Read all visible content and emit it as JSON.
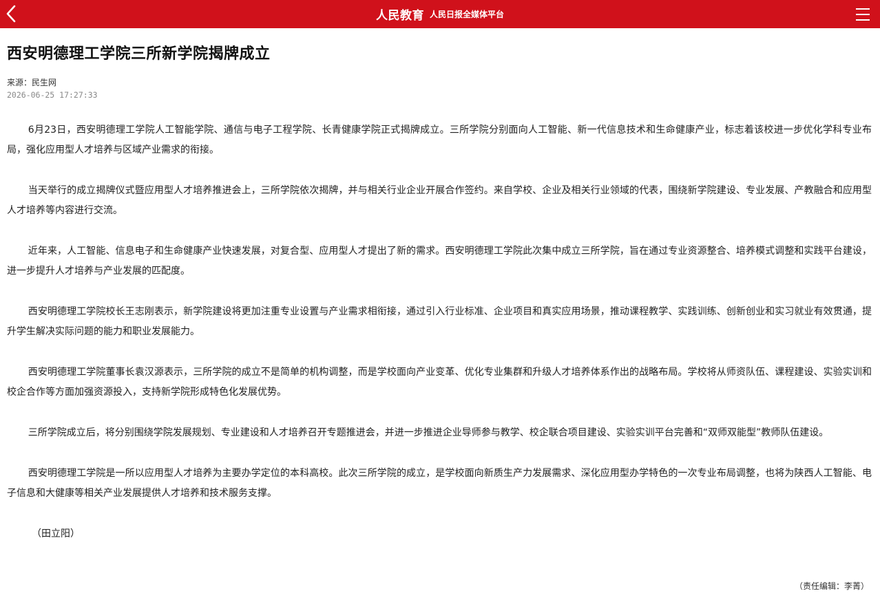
{
  "header": {
    "brand": "人民教育",
    "subtitle": "人民日报全媒体平台",
    "accent_color": "#d0111b",
    "left_icon": "chevron-left-icon",
    "right_icon": "hamburger-menu-icon"
  },
  "article": {
    "title": "西安明德理工学院三所新学院揭牌成立",
    "source": "来源：民生网",
    "date": "2026-06-25 17:27:33",
    "paragraphs": [
      "6月23日，西安明德理工学院人工智能学院、通信与电子工程学院、长青健康学院正式揭牌成立。三所学院分别面向人工智能、新一代信息技术和生命健康产业，标志着该校进一步优化学科专业布局，强化应用型人才培养与区域产业需求的衔接。",
      "当天举行的成立揭牌仪式暨应用型人才培养推进会上，三所学院依次揭牌，并与相关行业企业开展合作签约。来自学校、企业及相关行业领域的代表，围绕新学院建设、专业发展、产教融合和应用型人才培养等内容进行交流。",
      "近年来，人工智能、信息电子和生命健康产业快速发展，对复合型、应用型人才提出了新的需求。西安明德理工学院此次集中成立三所学院，旨在通过专业资源整合、培养模式调整和实践平台建设，进一步提升人才培养与产业发展的匹配度。",
      "西安明德理工学院校长王志刚表示，新学院建设将更加注重专业设置与产业需求相衔接，通过引入行业标准、企业项目和真实应用场景，推动课程教学、实践训练、创新创业和实习就业有效贯通，提升学生解决实际问题的能力和职业发展能力。",
      "西安明德理工学院董事长袁汉源表示，三所学院的成立不是简单的机构调整，而是学校面向产业变革、优化专业集群和升级人才培养体系作出的战略布局。学校将从师资队伍、课程建设、实验实训和校企合作等方面加强资源投入，支持新学院形成特色化发展优势。",
      "三所学院成立后，将分别围绕学院发展规划、专业建设和人才培养召开专题推进会，并进一步推进企业导师参与教学、校企联合项目建设、实验实训平台完善和“双师双能型”教师队伍建设。",
      "西安明德理工学院是一所以应用型人才培养为主要办学定位的本科高校。此次三所学院的成立，是学校面向新质生产力发展需求、深化应用型办学特色的一次专业布局调整，也将为陕西人工智能、电子信息和大健康等相关产业发展提供人才培养和技术服务支撑。"
    ],
    "author": "（田立阳）",
    "editor": "（责任编辑：李菁）"
  }
}
